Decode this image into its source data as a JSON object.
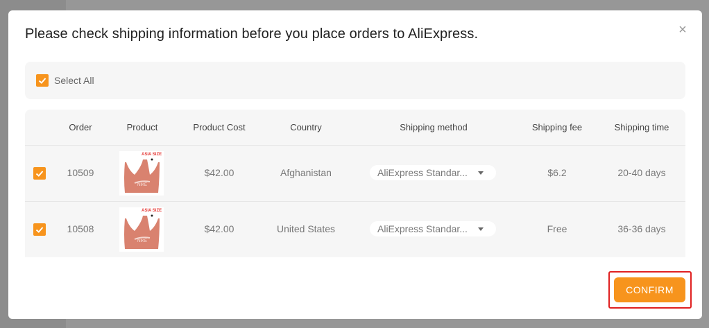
{
  "dialog": {
    "title": "Please check shipping information before you place orders to AliExpress.",
    "close_glyph": "×",
    "select_all_label": "Select All",
    "confirm_label": "CONFIRM",
    "accent_color": "#f7941d",
    "highlight_color": "#e02020"
  },
  "table": {
    "headers": [
      "Order",
      "Product",
      "Product Cost",
      "Country",
      "Shipping method",
      "Shipping fee",
      "Shipping time"
    ],
    "rows": [
      {
        "checked": true,
        "order": "10509",
        "product_image": "pink-sports-bra",
        "product_badge": "ASIA SIZE",
        "cost": "$42.00",
        "country": "Afghanistan",
        "shipping_method": "AliExpress Standar...",
        "shipping_fee": "$6.2",
        "shipping_time": "20-40 days"
      },
      {
        "checked": true,
        "order": "10508",
        "product_image": "pink-sports-bra",
        "product_badge": "ASIA SIZE",
        "cost": "$42.00",
        "country": "United States",
        "shipping_method": "AliExpress Standar...",
        "shipping_fee": "Free",
        "shipping_time": "36-36 days"
      }
    ]
  }
}
